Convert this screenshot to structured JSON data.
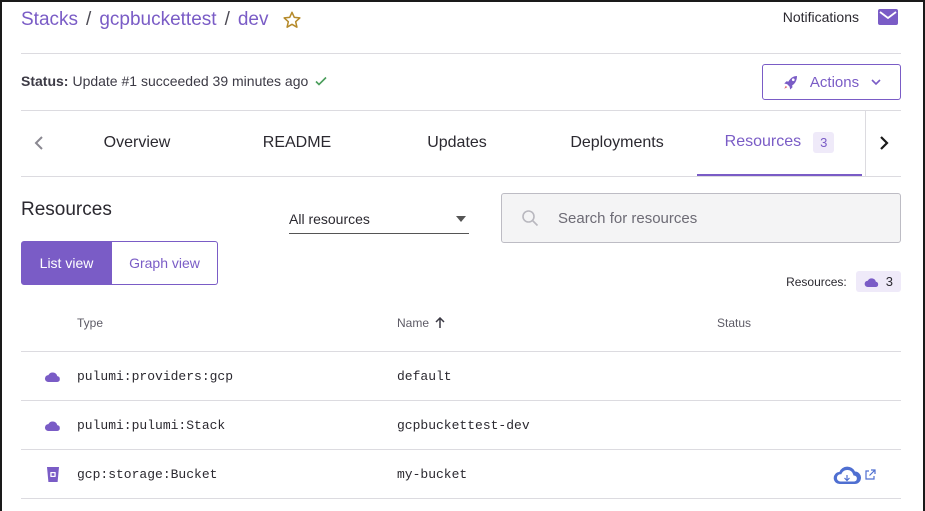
{
  "breadcrumb": {
    "items": [
      "Stacks",
      "gcpbuckettest",
      "dev"
    ],
    "separator": "/"
  },
  "header": {
    "notifications_label": "Notifications"
  },
  "status": {
    "label": "Status:",
    "text": "Update #1 succeeded 39 minutes ago"
  },
  "actions": {
    "label": "Actions"
  },
  "tabs": [
    {
      "label": "Overview"
    },
    {
      "label": "README"
    },
    {
      "label": "Updates"
    },
    {
      "label": "Deployments"
    },
    {
      "label": "Resources",
      "badge": "3",
      "active": true
    }
  ],
  "resources": {
    "heading": "Resources",
    "filter": {
      "selected": "All resources"
    },
    "search": {
      "placeholder": "Search for resources"
    },
    "view_toggle": {
      "list": "List view",
      "graph": "Graph view",
      "active": "list"
    },
    "count_label": "Resources:",
    "count": "3"
  },
  "table": {
    "columns": {
      "type": "Type",
      "name": "Name",
      "status": "Status"
    },
    "rows": [
      {
        "icon": "cloud-icon",
        "type": "pulumi:providers:gcp",
        "name": "default"
      },
      {
        "icon": "cloud-icon",
        "type": "pulumi:pulumi:Stack",
        "name": "gcpbuckettest-dev"
      },
      {
        "icon": "bucket-icon",
        "type": "gcp:storage:Bucket",
        "name": "my-bucket",
        "status_icons": [
          "cloud-console-icon",
          "external-link-icon"
        ]
      }
    ]
  },
  "colors": {
    "accent": "#7a5cc6",
    "star": "#b58a2a",
    "success": "#4a9d5b",
    "console_blue": "#4f6fd1"
  }
}
